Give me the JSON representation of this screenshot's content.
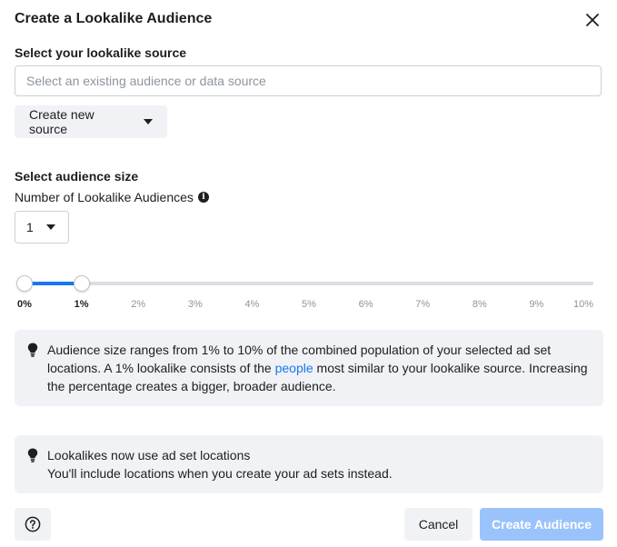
{
  "dialog": {
    "title": "Create a Lookalike Audience"
  },
  "source": {
    "heading": "Select your lookalike source",
    "placeholder": "Select an existing audience or data source",
    "create_new_label": "Create new source"
  },
  "size": {
    "heading": "Select audience size",
    "count_label": "Number of Lookalike Audiences",
    "count_value": "1",
    "slider": {
      "range_min": 0,
      "range_max": 10,
      "selected_start": 0,
      "selected_end": 1,
      "ticks": [
        "0%",
        "1%",
        "2%",
        "3%",
        "4%",
        "5%",
        "6%",
        "7%",
        "8%",
        "9%",
        "10%"
      ],
      "accent_color": "#1877f2"
    }
  },
  "info1": {
    "line1": "Audience size ranges from 1% to 10% of the combined population of your selected ad set",
    "line2_before": "locations. A 1% lookalike consists of the ",
    "link": "people",
    "line2_after": " most similar to your lookalike source. Increasing",
    "line3": "the percentage creates a bigger, broader audience."
  },
  "info2": {
    "line1": "Lookalikes now use ad set locations",
    "line2": "You'll include locations when you create your ad sets instead."
  },
  "footer": {
    "help_icon": "question-circle-icon",
    "cancel_label": "Cancel",
    "create_label": "Create Audience",
    "create_color": "#9bc3fb"
  }
}
